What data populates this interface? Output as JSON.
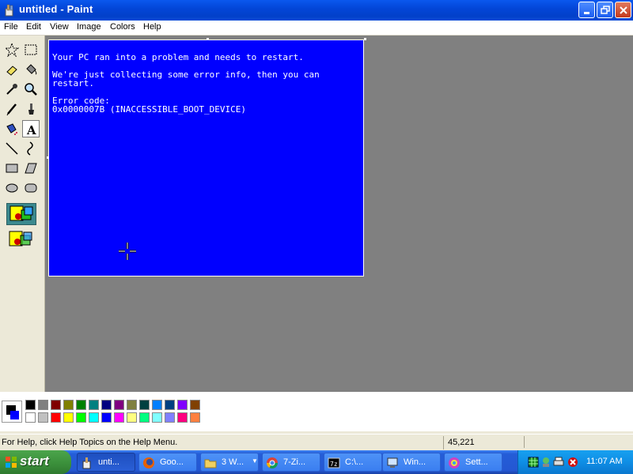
{
  "window": {
    "title": "untitled - Paint"
  },
  "menu": [
    "File",
    "Edit",
    "View",
    "Image",
    "Colors",
    "Help"
  ],
  "canvas": {
    "lines": [
      "Your PC ran into a problem and needs to restart.",
      "",
      "We're just collecting some error info, then you can",
      "restart.",
      "",
      "Error code:",
      "0x0000007B (INACCESSIBLE_BOOT_DEVICE)"
    ],
    "background": "#0000ff"
  },
  "toolbox": {
    "tools": [
      "free-form-select",
      "select",
      "eraser",
      "fill",
      "pick-color",
      "magnifier",
      "pencil",
      "brush",
      "airbrush",
      "text",
      "line",
      "curve",
      "rectangle",
      "polygon",
      "ellipse",
      "rounded-rectangle"
    ],
    "active_tool": "text"
  },
  "palette": {
    "row1": [
      "#000000",
      "#808080",
      "#800000",
      "#808000",
      "#008000",
      "#008080",
      "#000080",
      "#800080",
      "#808040",
      "#004040",
      "#0080ff",
      "#004080",
      "#8000ff",
      "#804000"
    ],
    "row2": [
      "#ffffff",
      "#c0c0c0",
      "#ff0000",
      "#ffff00",
      "#00ff00",
      "#00ffff",
      "#0000ff",
      "#ff00ff",
      "#ffff80",
      "#00ff80",
      "#80ffff",
      "#8080ff",
      "#ff0080",
      "#ff8040"
    ],
    "foreground": "#000000",
    "background": "#0000ff"
  },
  "status": {
    "help": "For Help, click Help Topics on the Help Menu.",
    "coords": "45,221"
  },
  "taskbar": {
    "start": "start",
    "tasks": [
      {
        "label": "unti...",
        "icon": "paint-icon",
        "active": true
      },
      {
        "label": "Goo...",
        "icon": "firefox-icon",
        "active": false
      },
      {
        "label": "3 W...",
        "icon": "folder-icon",
        "active": false
      },
      {
        "label": "7-Zi...",
        "icon": "chrome-icon",
        "active": false
      },
      {
        "label": "C:\\...",
        "icon": "cmd-icon",
        "active": false
      },
      {
        "label": "Win...",
        "icon": "computer-icon",
        "active": false
      },
      {
        "label": "Sett...",
        "icon": "settings-icon",
        "active": false
      }
    ],
    "clock": "11:07 AM"
  }
}
